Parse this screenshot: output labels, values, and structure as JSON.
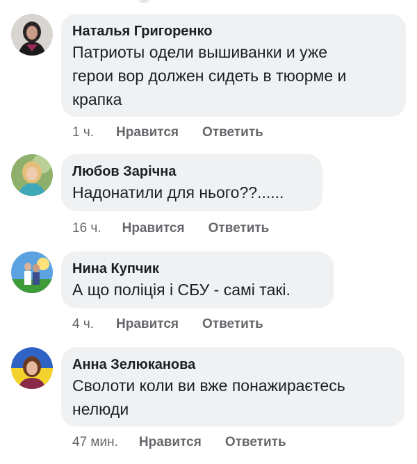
{
  "comments": [
    {
      "author": "Наталья Григоренко",
      "text_lines": [
        "Патриоты одели вышиванки и уже",
        "герои вор должен сидеть в тюорме и",
        "крапка"
      ],
      "time": "1 ч.",
      "like": "Нравится",
      "reply": "Ответить",
      "avatar_icon": "profile-photo-woman-dark-hair"
    },
    {
      "author": "Любов Зарічна",
      "text_lines": [
        "Надонатили для нього??......"
      ],
      "time": "16 ч.",
      "like": "Нравится",
      "reply": "Ответить",
      "avatar_icon": "profile-photo-woman-blonde"
    },
    {
      "author": "Нина Купчик",
      "text_lines": [
        "А що поліція і СБУ - самі такі."
      ],
      "time": "4 ч.",
      "like": "Нравится",
      "reply": "Ответить",
      "avatar_icon": "profile-photo-couple-sky"
    },
    {
      "author": "Анна Зелюканова",
      "text_lines": [
        "Сволоти коли ви вже понажираєтесь",
        "нелюди"
      ],
      "time": "47 мин.",
      "like": "Нравится",
      "reply": "Ответить",
      "avatar_icon": "profile-photo-woman-flag"
    }
  ],
  "colors": {
    "bubble": "#eff1f3",
    "text": "#1c1e21",
    "meta": "#65676b"
  }
}
